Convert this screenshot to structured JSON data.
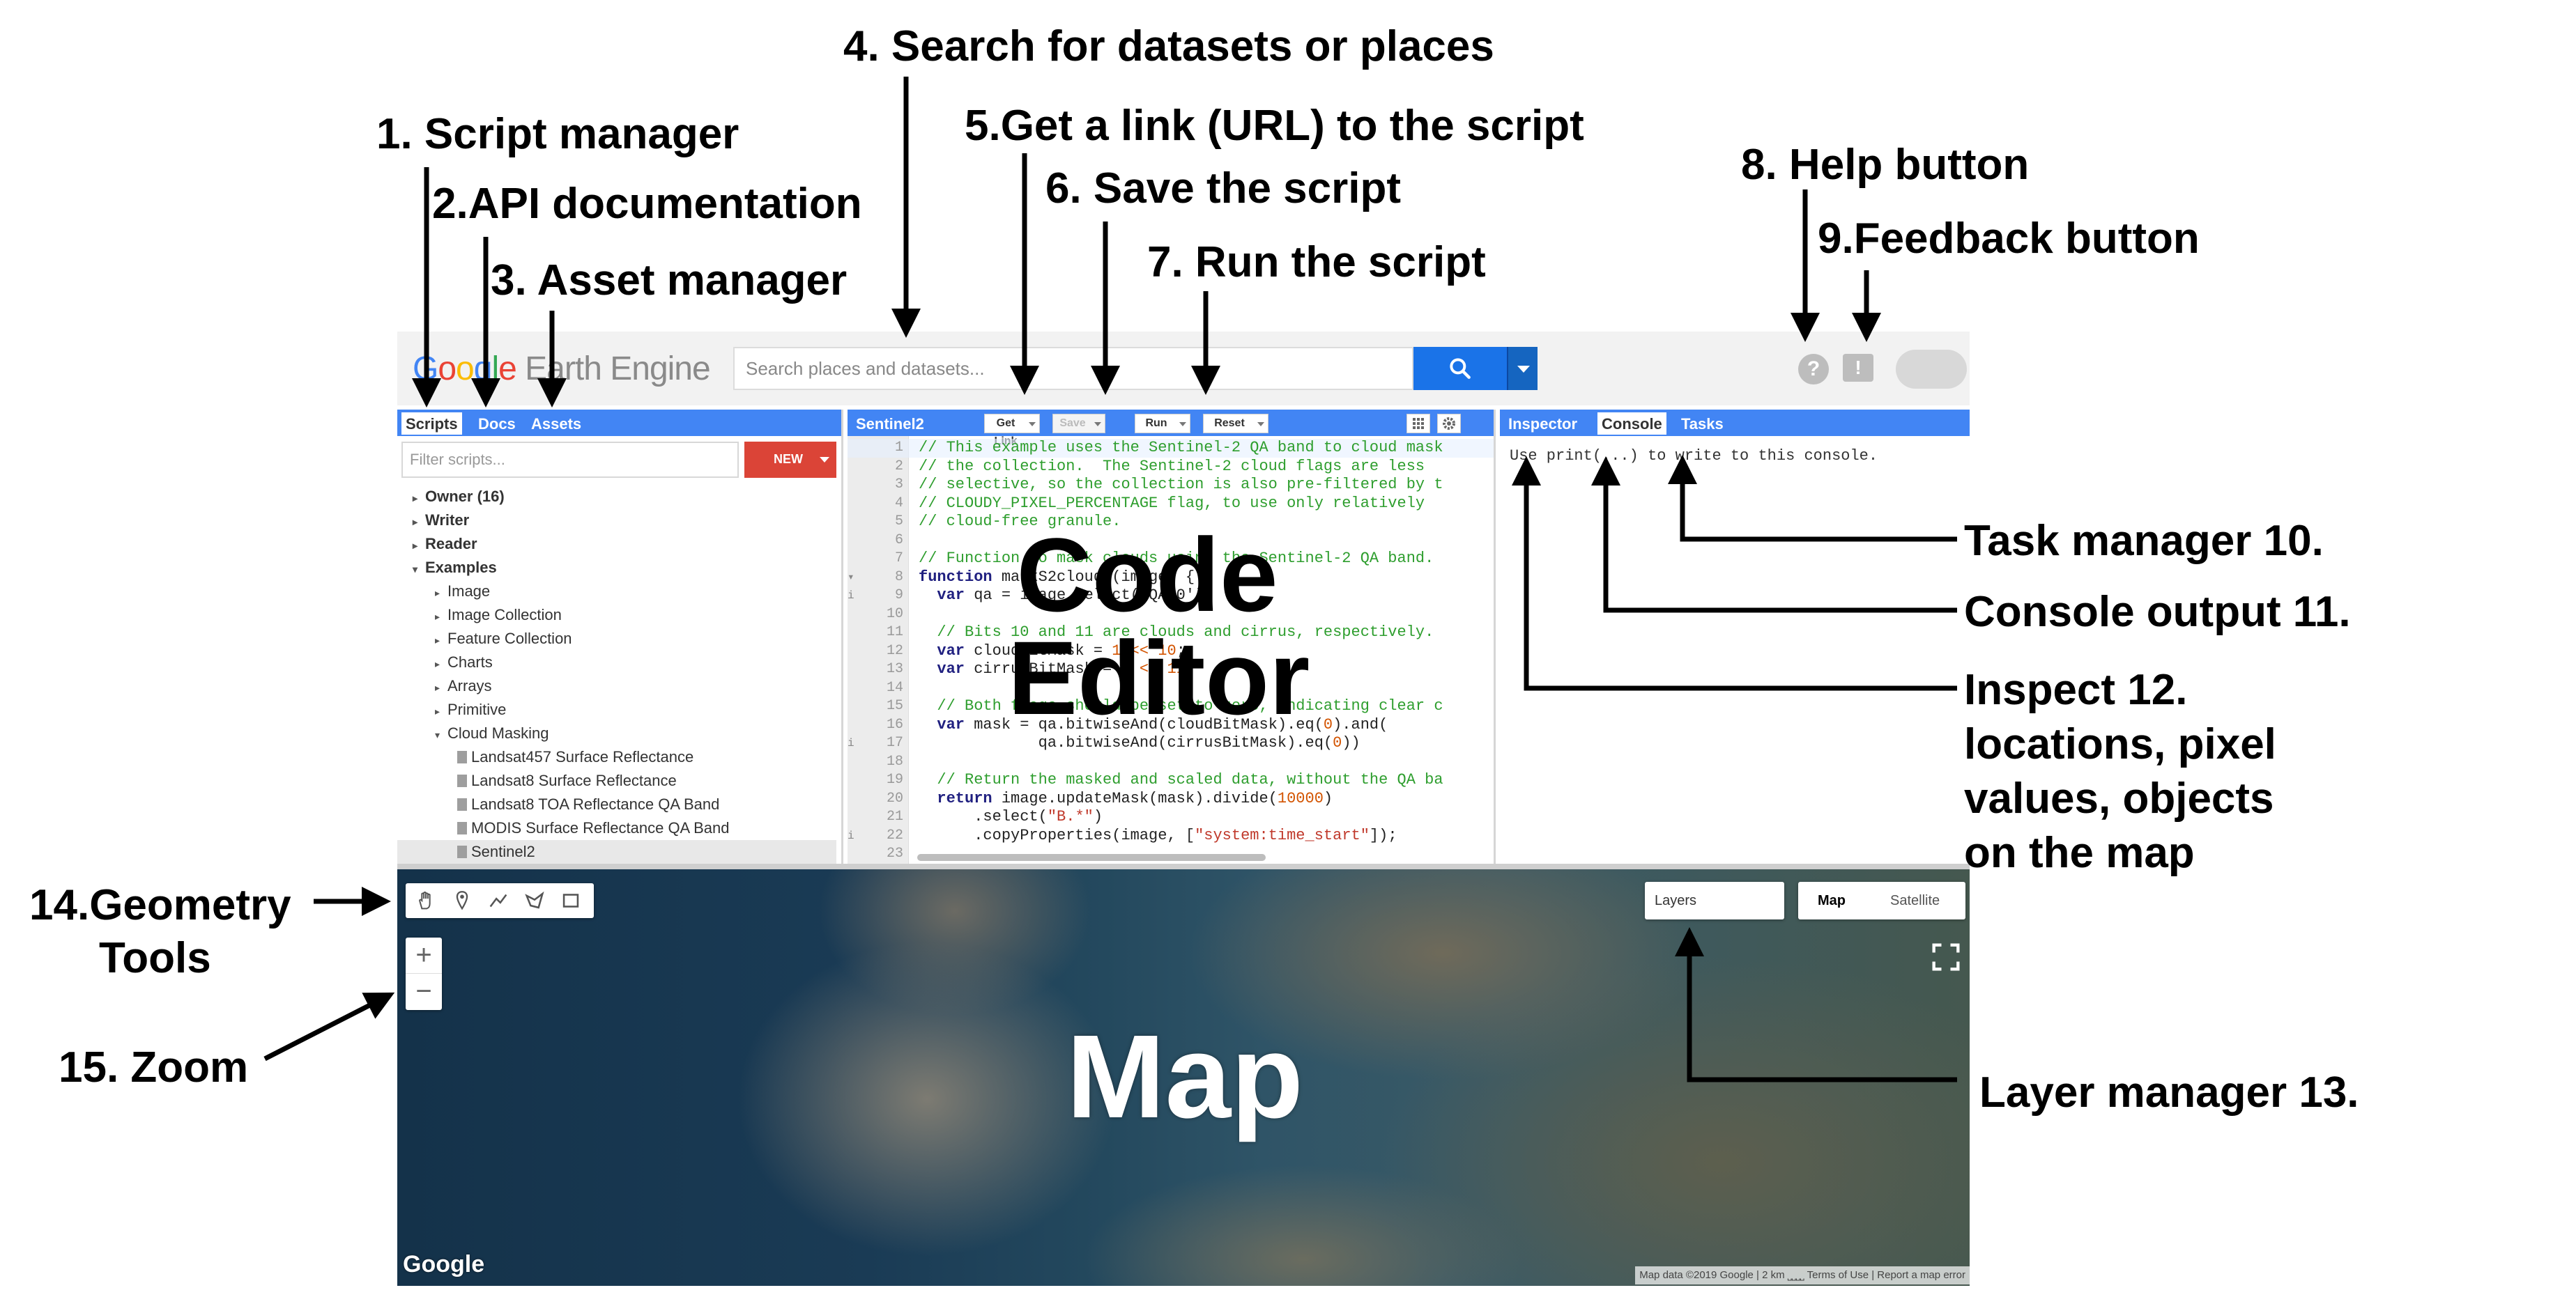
{
  "app": {
    "logo": [
      "G",
      "o",
      "o",
      "g",
      "l",
      "e"
    ],
    "logo_rest": " Earth Engine",
    "search_placeholder": "Search places and datasets...",
    "help_label": "?",
    "feedback_label": "!"
  },
  "left_panel": {
    "tabs": [
      "Scripts",
      "Docs",
      "Assets"
    ],
    "filter_placeholder": "Filter scripts...",
    "new_button": "NEW",
    "tree": [
      {
        "label": "Owner (16)",
        "level": 0,
        "bold": true,
        "caret": "▸"
      },
      {
        "label": "Writer",
        "level": 0,
        "bold": true,
        "caret": "▸"
      },
      {
        "label": "Reader",
        "level": 0,
        "bold": true,
        "caret": "▸"
      },
      {
        "label": "Examples",
        "level": 0,
        "bold": true,
        "caret": "▾"
      },
      {
        "label": "Image",
        "level": 1,
        "caret": "▸"
      },
      {
        "label": "Image Collection",
        "level": 1,
        "caret": "▸"
      },
      {
        "label": "Feature Collection",
        "level": 1,
        "caret": "▸"
      },
      {
        "label": "Charts",
        "level": 1,
        "caret": "▸"
      },
      {
        "label": "Arrays",
        "level": 1,
        "caret": "▸"
      },
      {
        "label": "Primitive",
        "level": 1,
        "caret": "▸"
      },
      {
        "label": "Cloud Masking",
        "level": 1,
        "caret": "▾"
      },
      {
        "label": "Landsat457 Surface Reflectance",
        "level": 2,
        "file": true
      },
      {
        "label": "Landsat8 Surface Reflectance",
        "level": 2,
        "file": true
      },
      {
        "label": "Landsat8 TOA Reflectance QA Band",
        "level": 2,
        "file": true
      },
      {
        "label": "MODIS Surface Reflectance QA Band",
        "level": 2,
        "file": true
      },
      {
        "label": "Sentinel2",
        "level": 2,
        "file": true,
        "selected": true
      }
    ]
  },
  "editor": {
    "script_name": "Sentinel2",
    "buttons": {
      "get_link": "Get Link",
      "save": "Save",
      "run": "Run",
      "reset": "Reset"
    },
    "lines": [
      {
        "n": "1",
        "parts": [
          [
            "c",
            "// This example uses the Sentinel-2 QA band to cloud mask"
          ]
        ]
      },
      {
        "n": "2",
        "parts": [
          [
            "c",
            "// the collection.  The Sentinel-2 cloud flags are less"
          ]
        ]
      },
      {
        "n": "3",
        "parts": [
          [
            "c",
            "// selective, so the collection is also pre-filtered by t"
          ]
        ]
      },
      {
        "n": "4",
        "parts": [
          [
            "c",
            "// CLOUDY_PIXEL_PERCENTAGE flag, to use only relatively"
          ]
        ]
      },
      {
        "n": "5",
        "parts": [
          [
            "c",
            "// cloud-free granule."
          ]
        ]
      },
      {
        "n": "6",
        "parts": []
      },
      {
        "n": "7",
        "parts": [
          [
            "c",
            "// Function to mask clouds using the Sentinel-2 QA band."
          ]
        ]
      },
      {
        "n": "8",
        "fold": "▾",
        "parts": [
          [
            "k",
            "function "
          ],
          [
            "t",
            "maskS2clouds(image) {"
          ]
        ]
      },
      {
        "n": "9",
        "fold": "i",
        "parts": [
          [
            "k",
            "  var "
          ],
          [
            "t",
            "qa = image.select('QA60');"
          ]
        ]
      },
      {
        "n": "10",
        "parts": []
      },
      {
        "n": "11",
        "parts": [
          [
            "c",
            "  // Bits 10 and 11 are clouds and cirrus, respectively."
          ]
        ]
      },
      {
        "n": "12",
        "parts": [
          [
            "k",
            "  var "
          ],
          [
            "t",
            "cloudBitMask = "
          ],
          [
            "m",
            "1 << 10"
          ],
          [
            "t",
            ";"
          ]
        ]
      },
      {
        "n": "13",
        "parts": [
          [
            "k",
            "  var "
          ],
          [
            "t",
            "cirrusBitMask = "
          ],
          [
            "m",
            "1 << 11"
          ],
          [
            "t",
            ";"
          ]
        ]
      },
      {
        "n": "14",
        "parts": []
      },
      {
        "n": "15",
        "parts": [
          [
            "c",
            "  // Both flags should be set to zero, indicating clear c"
          ]
        ]
      },
      {
        "n": "16",
        "parts": [
          [
            "k",
            "  var "
          ],
          [
            "t",
            "mask = qa.bitwiseAnd(cloudBitMask).eq("
          ],
          [
            "m",
            "0"
          ],
          [
            "t",
            ").and("
          ]
        ]
      },
      {
        "n": "17",
        "fold": "i",
        "parts": [
          [
            "t",
            "             qa.bitwiseAnd(cirrusBitMask).eq("
          ],
          [
            "m",
            "0"
          ],
          [
            "t",
            "))"
          ]
        ]
      },
      {
        "n": "18",
        "parts": []
      },
      {
        "n": "19",
        "parts": [
          [
            "c",
            "  // Return the masked and scaled data, without the QA ba"
          ]
        ]
      },
      {
        "n": "20",
        "parts": [
          [
            "k",
            "  return "
          ],
          [
            "t",
            "image.updateMask(mask).divide("
          ],
          [
            "m",
            "10000"
          ],
          [
            "t",
            ")"
          ]
        ]
      },
      {
        "n": "21",
        "parts": [
          [
            "t",
            "      .select("
          ],
          [
            "s",
            "\"B.*\""
          ],
          [
            "t",
            ")"
          ]
        ]
      },
      {
        "n": "22",
        "fold": "i",
        "parts": [
          [
            "t",
            "      .copyProperties(image, ["
          ],
          [
            "s",
            "\"system:time_start\""
          ],
          [
            "t",
            "]);"
          ]
        ]
      },
      {
        "n": "23",
        "parts": []
      }
    ],
    "overlay_label": [
      "Code",
      "Editor"
    ]
  },
  "right_panel": {
    "tabs": [
      "Inspector",
      "Console",
      "Tasks"
    ],
    "console_text": "Use print(...) to write to this console."
  },
  "map": {
    "layers_label": "Layers",
    "map_types": [
      "Map",
      "Satellite"
    ],
    "zoom_in": "+",
    "zoom_out": "−",
    "google_mark": "Google",
    "attribution": "Map data ©2019 Google | 2 km ⎵⎵⎵⎵   Terms of Use | Report a map error",
    "overlay_label": "Map"
  },
  "annotations": {
    "a1": "1. Script manager",
    "a2": "2.API documentation",
    "a3": "3. Asset manager",
    "a4": "4. Search for datasets or places",
    "a5": "5.Get a link (URL) to the script",
    "a6": "6. Save the script",
    "a7": "7. Run the script",
    "a8": "8. Help button",
    "a9": "9.Feedback button",
    "a10": "Task manager 10.",
    "a11": "Console output 11.",
    "a12": [
      "Inspect 12.",
      "locations, pixel",
      "values, objects",
      "on the map"
    ],
    "a13": "Layer manager 13.",
    "a14": [
      "14.Geometry",
      "Tools"
    ],
    "a15": "15. Zoom"
  }
}
